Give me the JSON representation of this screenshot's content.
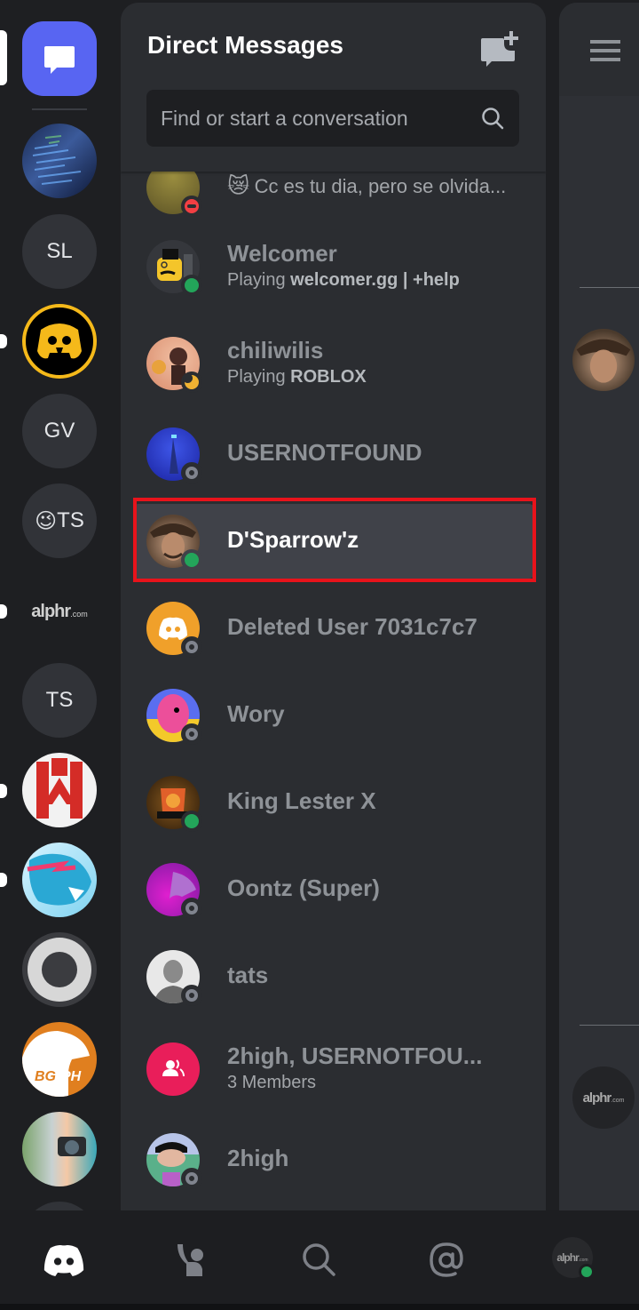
{
  "header": {
    "title": "Direct Messages",
    "new_dm_icon": "new-message-plus-icon",
    "search_placeholder": "Find or start a conversation",
    "search_value": "",
    "search_icon": "search-icon"
  },
  "rail": {
    "home_icon": "chat-bubble-icon",
    "servers": [
      {
        "label": "",
        "kind": "image",
        "desc": "code-screen",
        "unread": false
      },
      {
        "label": "SL",
        "kind": "text",
        "unread": false
      },
      {
        "label": "",
        "kind": "image",
        "desc": "brawl-stars-logo",
        "unread": true
      },
      {
        "label": "GV",
        "kind": "text",
        "unread": false
      },
      {
        "label": "TS",
        "kind": "emoji-text",
        "emoji": "😉",
        "unread": false
      },
      {
        "label": "alphr",
        "suffix": ".com",
        "kind": "logo",
        "unread": true
      },
      {
        "label": "TS",
        "kind": "text",
        "unread": false
      },
      {
        "label": "",
        "kind": "image",
        "desc": "red-w-logo",
        "unread": true
      },
      {
        "label": "",
        "kind": "image",
        "desc": "blue-panther-logo",
        "unread": true
      },
      {
        "label": "",
        "kind": "image",
        "desc": "ring-logo",
        "unread": false
      },
      {
        "label": "BG PH",
        "kind": "image",
        "desc": "bgph-chicken-logo",
        "unread": false
      },
      {
        "label": "",
        "kind": "image",
        "desc": "camera-kid-photo",
        "unread": false
      }
    ]
  },
  "dms": [
    {
      "name": "",
      "sub_emoji": "😿",
      "sub": "Cc es tu dia, pero se olvida...",
      "status": "dnd",
      "avatar": "olive-photo",
      "partial": true
    },
    {
      "name": "Welcomer",
      "sub_prefix": "Playing ",
      "sub_bold": "welcomer.gg | +help",
      "status": "online",
      "avatar": "yellow-cat-bot"
    },
    {
      "name": "chiliwilis",
      "sub_prefix": "Playing ",
      "sub_bold": "ROBLOX",
      "status": "idle",
      "avatar": "anime-illustration"
    },
    {
      "name": "USERNOTFOUND",
      "status": "offline",
      "avatar": "blue-photo"
    },
    {
      "name": "D'Sparrow'z",
      "status": "online",
      "avatar": "pirate-photo",
      "selected": true
    },
    {
      "name": "Deleted User 7031c7c7",
      "status": "offline",
      "avatar": "discord-default-orange"
    },
    {
      "name": "Wory",
      "status": "offline",
      "avatar": "pink-creature"
    },
    {
      "name": "King Lester X",
      "status": "online",
      "avatar": "lion-crest"
    },
    {
      "name": "Oontz (Super)",
      "status": "offline",
      "avatar": "purple-dragon"
    },
    {
      "name": "tats",
      "status": "offline",
      "avatar": "grayscale-photo"
    },
    {
      "name": "2high, USERNOTFOU...",
      "sub": "3 Members",
      "status": "none",
      "avatar": "group-dm-icon"
    },
    {
      "name": "2high",
      "status": "offline",
      "avatar": "cartoon-character"
    }
  ],
  "right_panel": {
    "menu_icon": "hamburger-menu-icon",
    "avatars": [
      "pirate-photo",
      "alphr-logo"
    ],
    "alphr_label": "alphr",
    "alphr_suffix": ".com"
  },
  "bottom_nav": {
    "items": [
      {
        "name": "home",
        "icon": "discord-logo-icon",
        "active": true
      },
      {
        "name": "friends",
        "icon": "friends-wave-icon",
        "active": false
      },
      {
        "name": "search",
        "icon": "search-icon",
        "active": false
      },
      {
        "name": "mentions",
        "icon": "at-sign-icon",
        "active": false
      },
      {
        "name": "profile",
        "icon": "user-avatar",
        "active": false
      }
    ],
    "profile_label": "alphr",
    "profile_suffix": ".com",
    "profile_status": "online"
  },
  "colors": {
    "accent": "#5865f2",
    "online": "#23a55a",
    "idle": "#f0b232",
    "dnd": "#f23f43",
    "offline": "#80848e",
    "highlight": "#e8131b",
    "group_dm": "#e91e5a"
  }
}
